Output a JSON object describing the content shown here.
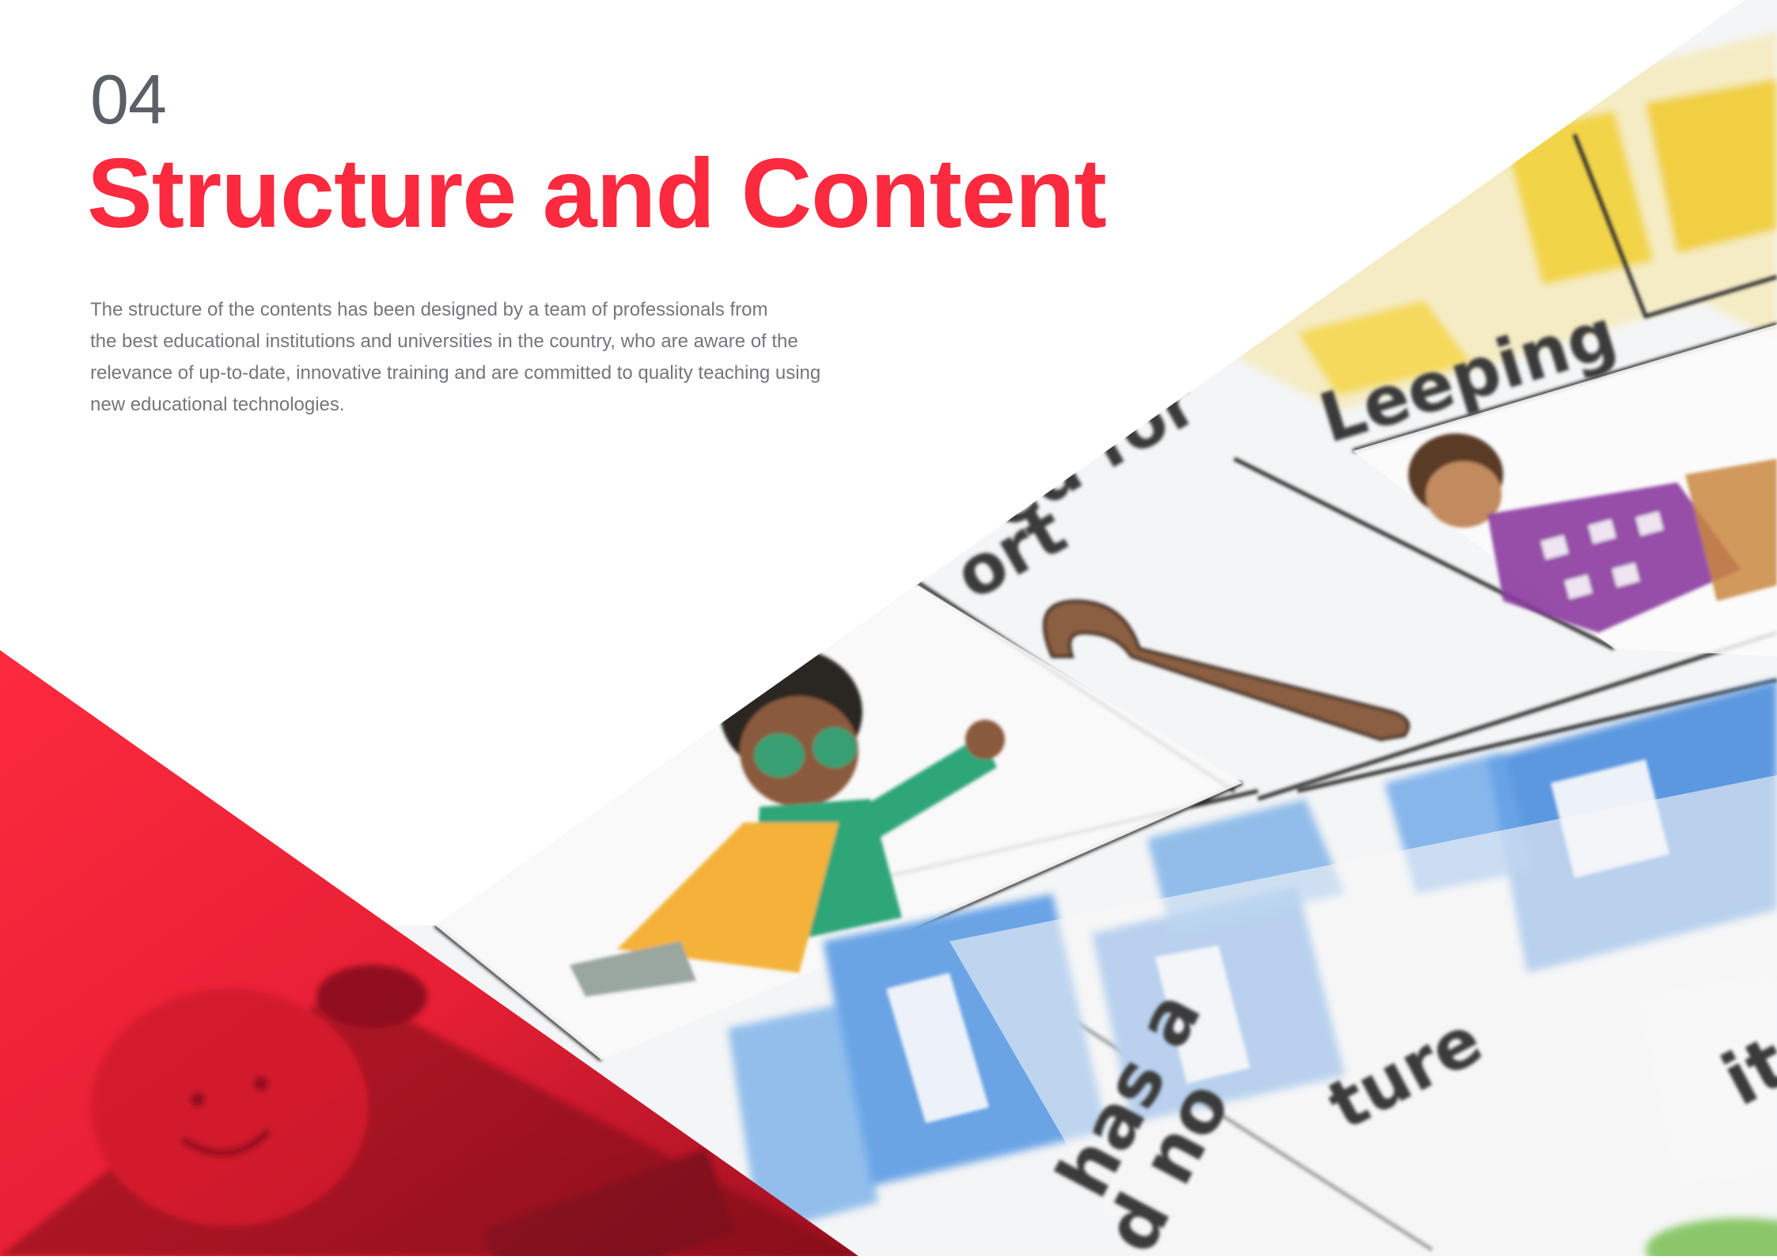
{
  "section": {
    "number": "04",
    "title": "Structure and Content",
    "body_lines": [
      "The structure of the contents has been designed by a team of professionals from",
      "the best educational institutions and universities in the country, who are aware of the",
      "relevance of up-to-date, innovative training and are committed to quality teaching using",
      "new educational technologies."
    ]
  },
  "photo": {
    "description_words": [
      "Leeping",
      "ed for",
      "ort",
      "has a",
      "d no",
      "ture",
      "ite"
    ]
  },
  "colors": {
    "accent": "#fb2a3e",
    "number_gray": "#5b5f66",
    "body_gray": "#74767b"
  }
}
